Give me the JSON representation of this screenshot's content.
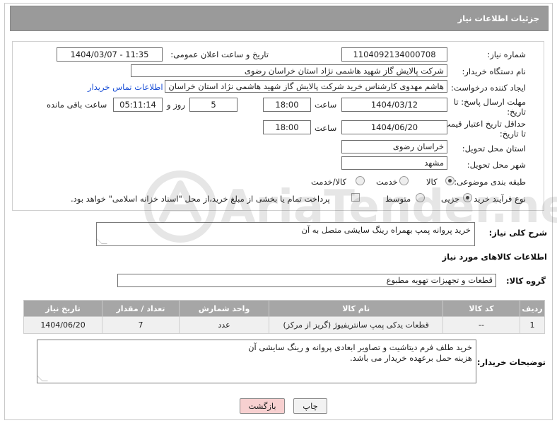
{
  "header": {
    "title": "جزئیات اطلاعات نیاز"
  },
  "fields": {
    "need_number_label": "شماره نیاز:",
    "need_number": "1104092134000708",
    "announce_label": "تاریخ و ساعت اعلان عمومی:",
    "announce_value": "1404/03/07 - 11:35",
    "buyer_org_label": "نام دستگاه خریدار:",
    "buyer_org": "شرکت پالایش گاز شهید هاشمی نژاد   استان خراسان رضوی",
    "creator_label": "ایجاد کننده درخواست:",
    "creator": "هاشم مهدوی کارشناس خرید شرکت پالایش گاز شهید هاشمی نژاد   استان خراسان رضوی",
    "contact_link": "اطلاعات تماس خریدار",
    "deadline_label_1": "مهلت ارسال پاسخ: تا",
    "deadline_label_2": "تاریخ:",
    "deadline_date": "1404/03/12",
    "time_label": "ساعت",
    "deadline_time": "18:00",
    "days_value": "5",
    "days_label": "روز و",
    "remaining_time": "05:11:14",
    "remaining_label": "ساعت باقی مانده",
    "validity_label_1": "حداقل تاریخ اعتبار قیمت:",
    "validity_label_2": "تا تاریخ:",
    "validity_date": "1404/06/20",
    "validity_time": "18:00",
    "province_label": "استان محل تحویل:",
    "province": "خراسان رضوی",
    "city_label": "شهر محل تحویل:",
    "city": "مشهد",
    "category_label": "طبقه بندی موضوعی:",
    "category_options": [
      "کالا",
      "خدمت",
      "کالا/خدمت"
    ],
    "process_label": "نوع فرآیند خرید :",
    "process_options": [
      "جزیی",
      "متوسط"
    ],
    "payment_note": "پرداخت تمام یا بخشی از مبلغ خرید،از محل \"اسناد خزانه اسلامی\" خواهد بود."
  },
  "summary": {
    "label": "شرح کلی نیاز:",
    "text": "خرید پروانه پمپ بهمراه رینگ سایشی متصل به آن"
  },
  "goods": {
    "section_title": "اطلاعات کالاهای مورد نیاز",
    "group_label": "گروه کالا:",
    "group_value": "قطعات و تجهیزات تهویه مطبوع"
  },
  "table": {
    "headers": [
      "ردیف",
      "کد کالا",
      "نام کالا",
      "واحد شمارش",
      "تعداد / مقدار",
      "تاریخ نیاز"
    ],
    "rows": [
      [
        "1",
        "--",
        "قطعات یدکی پمپ سانتریفیوژ (گریز از مرکز)",
        "عدد",
        "7",
        "1404/06/20"
      ]
    ]
  },
  "buyer_notes": {
    "label": "توضیحات خریدار:",
    "line1": "خرید طلف فرم دیتاشیت و تصاویر ابعادی پروانه و رینگ سایشی آن",
    "line2": "هزینه حمل برعهده خریدار می باشد."
  },
  "buttons": {
    "print": "چاپ",
    "back": "بازگشت"
  },
  "watermark": "AriaTender.neT",
  "colors": {
    "header_bg": "#9a9a9a",
    "link": "#1a4fd6",
    "back_btn_bg": "#f7d0d0"
  }
}
